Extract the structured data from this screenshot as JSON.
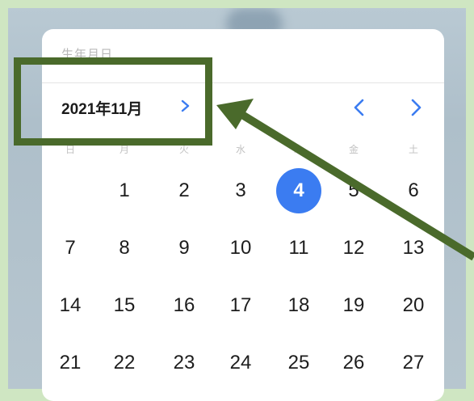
{
  "picker": {
    "faded_title": "生年月日",
    "month_label": "2021年11月",
    "weekdays": [
      "日",
      "月",
      "火",
      "水",
      "木",
      "金",
      "土"
    ],
    "days": [
      "1",
      "2",
      "3",
      "4",
      "5",
      "6",
      "7",
      "8",
      "9",
      "10",
      "11",
      "12",
      "13",
      "14",
      "15",
      "16",
      "17",
      "18",
      "19",
      "20",
      "21",
      "22",
      "23",
      "24",
      "25",
      "26",
      "27"
    ],
    "selected_day": "4"
  },
  "icons": {
    "month_expand": "chevron-right-icon",
    "prev_month": "chevron-left-icon",
    "next_month": "chevron-right-icon"
  },
  "colors": {
    "accent": "#3b7cf1",
    "annotation": "#4a6a2b",
    "frame": "#cfe6c2"
  }
}
